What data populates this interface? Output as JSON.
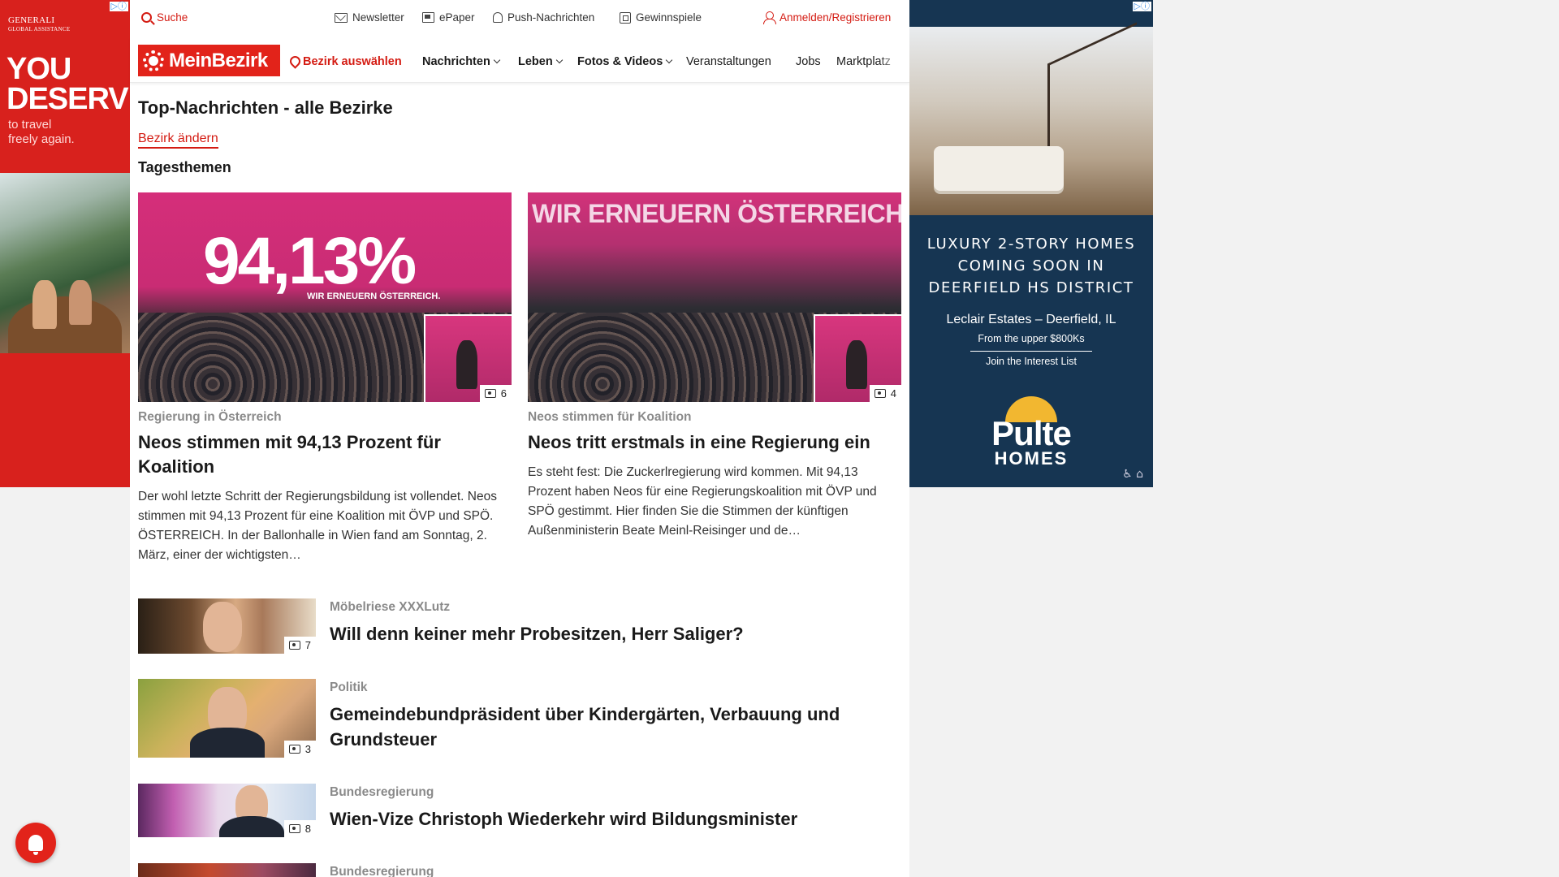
{
  "ads": {
    "left": {
      "brand": "GENERALI",
      "brand_sub": "GLOBAL ASSISTANCE",
      "headline_1": "YOU",
      "headline_2": "DESERVE",
      "tagline_1": "to travel",
      "tagline_2": "freely again."
    },
    "right": {
      "headline_1": "LUXURY 2-STORY HOMES",
      "headline_2": "COMING SOON IN",
      "headline_3": "DEERFIELD HS DISTRICT",
      "community": "Leclair Estates – Deerfield, IL",
      "price": "From the upper $800Ks",
      "cta": "Join the Interest List",
      "brand": "Pulte",
      "brand_sub": "HOMES"
    }
  },
  "topbar": {
    "search": "Suche",
    "newsletter": "Newsletter",
    "epaper": "ePaper",
    "push": "Push-Nachrichten",
    "games": "Gewinnspiele",
    "login": "Anmelden/Registrieren"
  },
  "nav": {
    "logo": "MeinBezirk",
    "district": "Bezirk auswählen",
    "items": [
      "Nachrichten",
      "Leben",
      "Fotos & Videos",
      "Veranstaltungen",
      "Jobs",
      "Marktplatz"
    ]
  },
  "page": {
    "title": "Top-Nachrichten - alle Bezirke",
    "change_link": "Bezirk ändern",
    "section": "Tagesthemen"
  },
  "featured": [
    {
      "image_text": "94,13%",
      "image_slogan": "WIR ERNEUERN ÖSTERREICH.",
      "gallery_count": "6",
      "kicker": "Regierung in Österreich",
      "headline": "Neos stimmen mit 94,13 Prozent für Koalition",
      "teaser": "Der wohl letzte Schritt der Regierungsbildung ist vollendet. Neos stimmen mit 94,13 Prozent für eine Koalition mit ÖVP und SPÖ. ÖSTERREICH. In der Ballonhalle in Wien fand am Sonntag, 2. März, einer der wichtigsten…"
    },
    {
      "image_text": "WIR ERNEUERN ÖSTERREICH",
      "gallery_count": "4",
      "kicker": "Neos stimmen für Koalition",
      "headline": "Neos tritt erstmals in eine Regierung ein",
      "teaser": "Es steht fest: Die Zuckerlregierung wird kommen. Mit 94,13 Prozent haben Neos für eine Regierungskoalition mit ÖVP und SPÖ gestimmt. Hier finden Sie die Stimmen der künftigen Außenministerin Beate Meinl-Reisinger und de…"
    }
  ],
  "list": [
    {
      "kicker": "Möbelriese XXXLutz",
      "headline": "Will denn keiner mehr Probesitzen, Herr Saliger?",
      "gallery_count": "7"
    },
    {
      "kicker": "Politik",
      "headline": "Gemeindebundpräsident über Kindergärten, Verbauung und Grundsteuer",
      "gallery_count": "3"
    },
    {
      "kicker": "Bundesregierung",
      "headline": "Wien-Vize Christoph Wiederkehr wird Bildungsminister",
      "gallery_count": "8"
    },
    {
      "kicker": "Bundesregierung",
      "headline": "",
      "gallery_count": ""
    }
  ],
  "colors": {
    "brand_red": "#e2231a",
    "link_red": "#d41b12",
    "ad_right_bg": "#163552"
  }
}
